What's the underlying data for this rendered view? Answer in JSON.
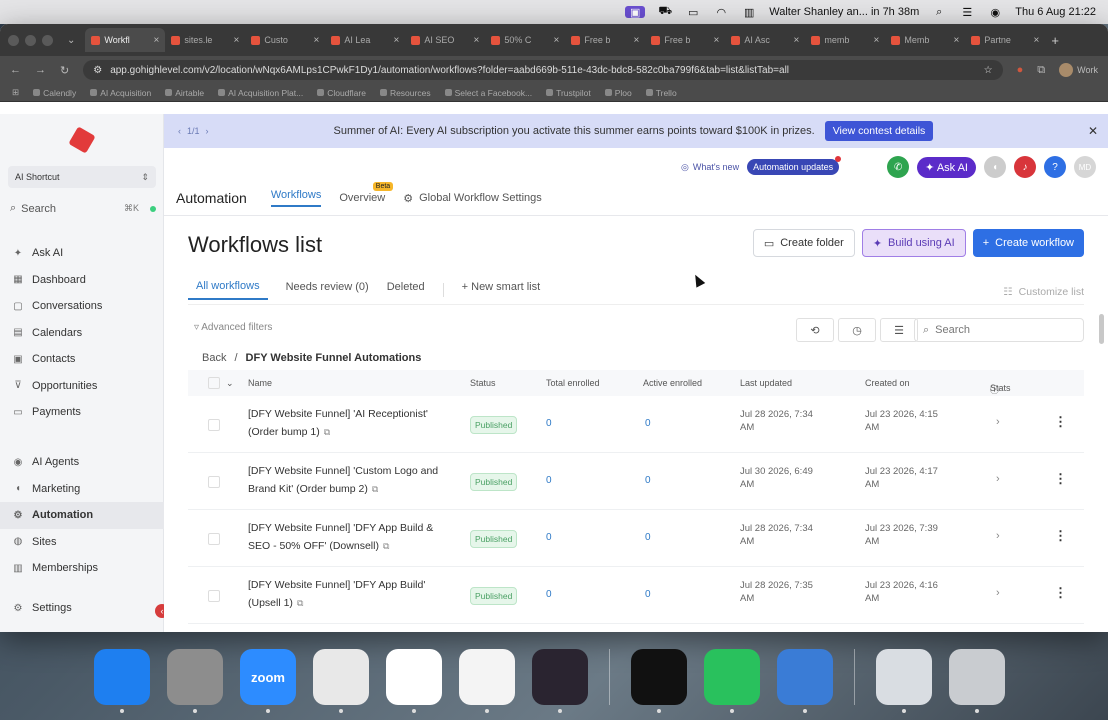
{
  "menubar": {
    "meeting_text": "Walter Shanley an... in 7h 38m",
    "datetime": "Thu 6 Aug 21:22"
  },
  "browser": {
    "tabs": [
      {
        "label": "Workfl",
        "active": true
      },
      {
        "label": "sites.le",
        "active": false
      },
      {
        "label": "Custo",
        "active": false
      },
      {
        "label": "AI Lea",
        "active": false
      },
      {
        "label": "AI SEO",
        "active": false
      },
      {
        "label": "50% C",
        "active": false
      },
      {
        "label": "Free b",
        "active": false
      },
      {
        "label": "Free b",
        "active": false
      },
      {
        "label": "AI Asc",
        "active": false
      },
      {
        "label": "memb",
        "active": false
      },
      {
        "label": "Memb",
        "active": false
      },
      {
        "label": "Partne",
        "active": false
      }
    ],
    "url": "app.gohighlevel.com/v2/location/wNqx6AMLps1CPwkF1Dy1/automation/workflows?folder=aabd669b-511e-43dc-bdc8-582c0ba799f6&tab=list&listTab=all",
    "profile_label": "Work",
    "bookmarks": [
      "Calendly",
      "AI Acquisition",
      "Airtable",
      "AI Acquisition Plat...",
      "Cloudflare",
      "Resources",
      "Select a Facebook...",
      "Trustpilot",
      "Ploo",
      "Trello"
    ]
  },
  "sidebar": {
    "account": "AI Shortcut",
    "search_placeholder": "Search",
    "search_shortcut": "⌘K",
    "items_top": [
      {
        "label": "Ask AI",
        "icon": "sparkle-icon"
      },
      {
        "label": "Dashboard",
        "icon": "dashboard-icon"
      },
      {
        "label": "Conversations",
        "icon": "chat-icon"
      },
      {
        "label": "Calendars",
        "icon": "calendar-icon"
      },
      {
        "label": "Contacts",
        "icon": "contacts-icon"
      },
      {
        "label": "Opportunities",
        "icon": "funnel-icon"
      },
      {
        "label": "Payments",
        "icon": "payments-icon"
      }
    ],
    "items_bottom": [
      {
        "label": "AI Agents",
        "icon": "bot-icon"
      },
      {
        "label": "Marketing",
        "icon": "megaphone-icon"
      },
      {
        "label": "Automation",
        "icon": "automation-icon",
        "active": true
      },
      {
        "label": "Sites",
        "icon": "globe-icon"
      },
      {
        "label": "Memberships",
        "icon": "membership-icon"
      }
    ],
    "settings": "Settings"
  },
  "banner": {
    "pager": "1/1",
    "message": "Summer of AI: Every AI subscription you activate this summer earns points toward $100K in prizes.",
    "cta": "View contest details"
  },
  "topbar": {
    "whats_new": "What's new",
    "automation_updates": "Automation updates",
    "ask_ai": "Ask AI",
    "avatar_initials": "MD"
  },
  "subnav": {
    "title": "Automation",
    "tabs": [
      "Workflows",
      "Overview",
      "Global Workflow Settings"
    ],
    "beta": "Beta"
  },
  "page": {
    "title": "Workflows list",
    "create_folder": "Create folder",
    "build_ai": "Build using AI",
    "create_workflow": "Create workflow",
    "filter_tabs": [
      "All workflows",
      "Needs review (0)",
      "Deleted"
    ],
    "new_smart_list": "New smart list",
    "customize_list": "Customize list",
    "advanced_filters": "Advanced filters",
    "search_placeholder": "Search",
    "back": "Back",
    "folder_name": "DFY Website Funnel Automations"
  },
  "table": {
    "columns": [
      "Name",
      "Status",
      "Total enrolled",
      "Active enrolled",
      "Last updated",
      "Created on",
      "Stats"
    ],
    "rows": [
      {
        "name": "[DFY Website Funnel] 'AI Receptionist' (Order bump 1)",
        "status": "Published",
        "total": "0",
        "active": "0",
        "updated": "Jul 28 2026, 7:34 AM",
        "created": "Jul 23 2026, 4:15 AM"
      },
      {
        "name": "[DFY Website Funnel] 'Custom Logo and Brand Kit' (Order bump 2)",
        "status": "Published",
        "total": "0",
        "active": "0",
        "updated": "Jul 30 2026, 6:49 AM",
        "created": "Jul 23 2026, 4:17 AM"
      },
      {
        "name": "[DFY Website Funnel] 'DFY App Build & SEO - 50% OFF' (Downsell)",
        "status": "Published",
        "total": "0",
        "active": "0",
        "updated": "Jul 28 2026, 7:34 AM",
        "created": "Jul 23 2026, 7:39 AM"
      },
      {
        "name": "[DFY Website Funnel] 'DFY App Build' (Upsell 1)",
        "status": "Published",
        "total": "0",
        "active": "0",
        "updated": "Jul 28 2026, 7:35 AM",
        "created": "Jul 23 2026, 4:16 AM"
      }
    ]
  },
  "dock": [
    {
      "name": "finder-icon",
      "label": "",
      "color": "#1e7ff0"
    },
    {
      "name": "settings-icon",
      "label": "",
      "color": "#8d8d8d"
    },
    {
      "name": "zoom-icon",
      "label": "zoom",
      "color": "#2d8cff"
    },
    {
      "name": "chrome-icon",
      "label": "",
      "color": "#e8e8e8"
    },
    {
      "name": "slack-icon",
      "label": "",
      "color": "#ffffff"
    },
    {
      "name": "chatgpt-icon",
      "label": "",
      "color": "#f4f4f4"
    },
    {
      "name": "audio-app-icon",
      "label": "",
      "color": "#2a2430"
    },
    {
      "name": "spotify-icon",
      "label": "",
      "color": "#111111"
    },
    {
      "name": "whatsapp-icon",
      "label": "",
      "color": "#29c15d"
    },
    {
      "name": "gear-app-icon",
      "label": "",
      "color": "#3a7cd6"
    },
    {
      "name": "preview-icon",
      "label": "",
      "color": "#d9dde2"
    },
    {
      "name": "trash-icon",
      "label": "",
      "color": "#c9ccd0"
    }
  ]
}
